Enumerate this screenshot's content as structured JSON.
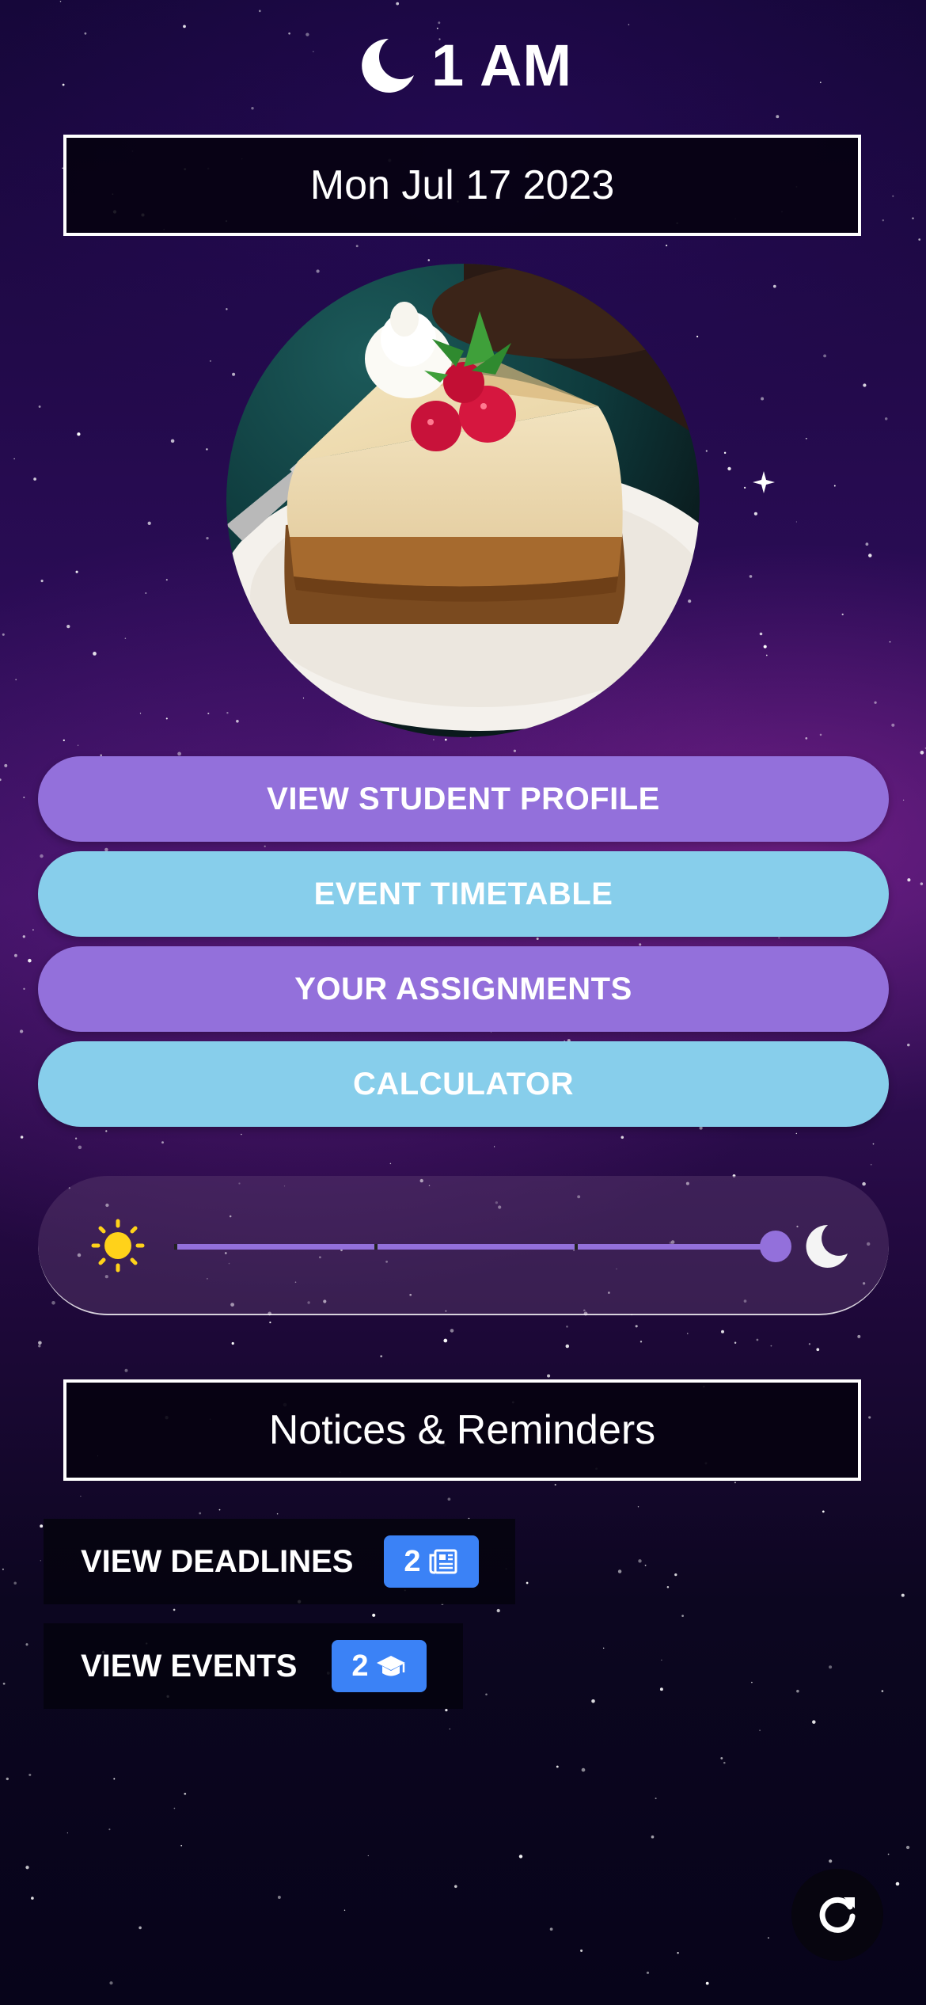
{
  "header": {
    "time": "1 AM",
    "icon": "moon-icon"
  },
  "date": {
    "text": "Mon Jul 17 2023"
  },
  "photo": {
    "subject": "cheesecake-slice-with-raspberries"
  },
  "menu": {
    "buttons": [
      {
        "label": "VIEW STUDENT PROFILE",
        "color": "#9370db"
      },
      {
        "label": "EVENT TIMETABLE",
        "color": "#87ceeb"
      },
      {
        "label": "YOUR ASSIGNMENTS",
        "color": "#9370db"
      },
      {
        "label": "CALCULATOR",
        "color": "#87ceeb"
      }
    ]
  },
  "theme_slider": {
    "left_icon": "sun-icon",
    "right_icon": "moon-icon",
    "value": 1.0,
    "steps": 3
  },
  "notices": {
    "title": "Notices & Reminders",
    "items": [
      {
        "label": "VIEW DEADLINES",
        "count": "2",
        "icon": "newspaper-icon"
      },
      {
        "label": "VIEW EVENTS",
        "count": "2",
        "icon": "graduation-cap-icon"
      }
    ]
  },
  "fab": {
    "icon": "refresh-icon"
  },
  "colors": {
    "purple": "#9370db",
    "sky": "#87ceeb",
    "badge": "#3b82f6",
    "sun": "#ffd21a"
  }
}
